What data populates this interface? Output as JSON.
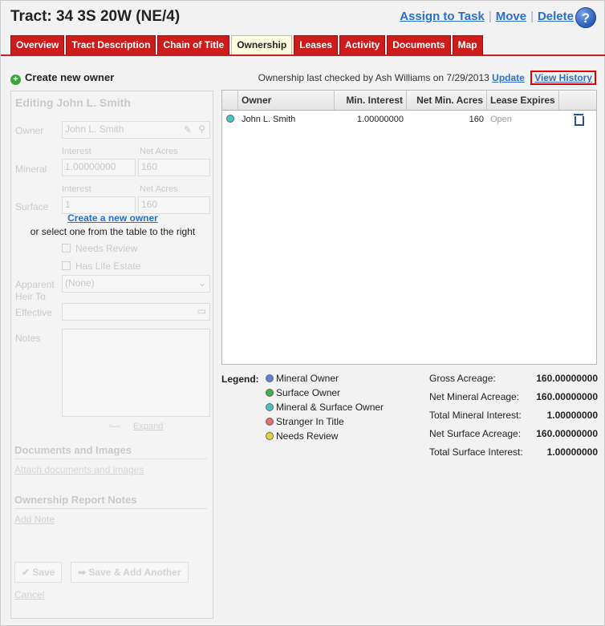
{
  "header": {
    "title": "Tract: 34 3S 20W (NE/4)",
    "actions": [
      "Assign to Task",
      "Move",
      "Delete"
    ],
    "help": "?"
  },
  "tabs": [
    {
      "label": "Overview",
      "active": false
    },
    {
      "label": "Tract Description",
      "active": false
    },
    {
      "label": "Chain of Title",
      "active": false
    },
    {
      "label": "Ownership",
      "active": true
    },
    {
      "label": "Leases",
      "active": false
    },
    {
      "label": "Activity",
      "active": false
    },
    {
      "label": "Documents",
      "active": false
    },
    {
      "label": "Map",
      "active": false
    }
  ],
  "left": {
    "create_owner": "Create new owner",
    "editing_title": "Editing John L. Smith",
    "owner_label": "Owner",
    "owner_value": "John L. Smith",
    "interest_label": "Interest",
    "net_acres_label": "Net Acres",
    "mineral_label": "Mineral",
    "mineral_interest": "1.00000000",
    "mineral_net_acres": "160",
    "surface_label": "Surface",
    "surface_interest": "1",
    "surface_net_acres": "160",
    "overlay_link": "Create a new owner",
    "overlay_text": "or select one from the table to the right",
    "needs_review": "Needs Review",
    "has_life_estate": "Has Life Estate",
    "apparent_heir_label": "Apparent Heir To",
    "apparent_heir_value": "(None)",
    "effective_label": "Effective",
    "notes_label": "Notes",
    "expand": "Expand",
    "documents_heading": "Documents and Images",
    "attach_link": "Attach documents and images",
    "report_notes_heading": "Ownership Report Notes",
    "add_note": "Add Note",
    "save": "Save",
    "save_add": "Save & Add Another",
    "cancel": "Cancel"
  },
  "right": {
    "checked_text": "Ownership last checked by Ash Williams on 7/29/2013",
    "update": "Update",
    "view_history": "View History",
    "columns": [
      "Owner",
      "Min. Interest",
      "Net Min. Acres",
      "Lease Expires"
    ],
    "rows": [
      {
        "owner": "John L. Smith",
        "min_interest": "1.00000000",
        "net_min_acres": "160",
        "lease_expires": "Open",
        "color": "#45c4c0"
      }
    ]
  },
  "legend": {
    "label": "Legend:",
    "items": [
      {
        "label": "Mineral Owner",
        "color": "#5b7fe0"
      },
      {
        "label": "Surface Owner",
        "color": "#3fb24a"
      },
      {
        "label": "Mineral & Surface Owner",
        "color": "#45c4c0"
      },
      {
        "label": "Stranger In Title",
        "color": "#ee6b73"
      },
      {
        "label": "Needs Review",
        "color": "#e2d23a"
      }
    ]
  },
  "stats": [
    {
      "label": "Gross Acreage:",
      "value": "160.00000000"
    },
    {
      "label": "Net Mineral Acreage:",
      "value": "160.00000000"
    },
    {
      "label": "Total Mineral Interest:",
      "value": "1.00000000"
    },
    {
      "label": "Net Surface Acreage:",
      "value": "160.00000000"
    },
    {
      "label": "Total Surface Interest:",
      "value": "1.00000000"
    }
  ]
}
